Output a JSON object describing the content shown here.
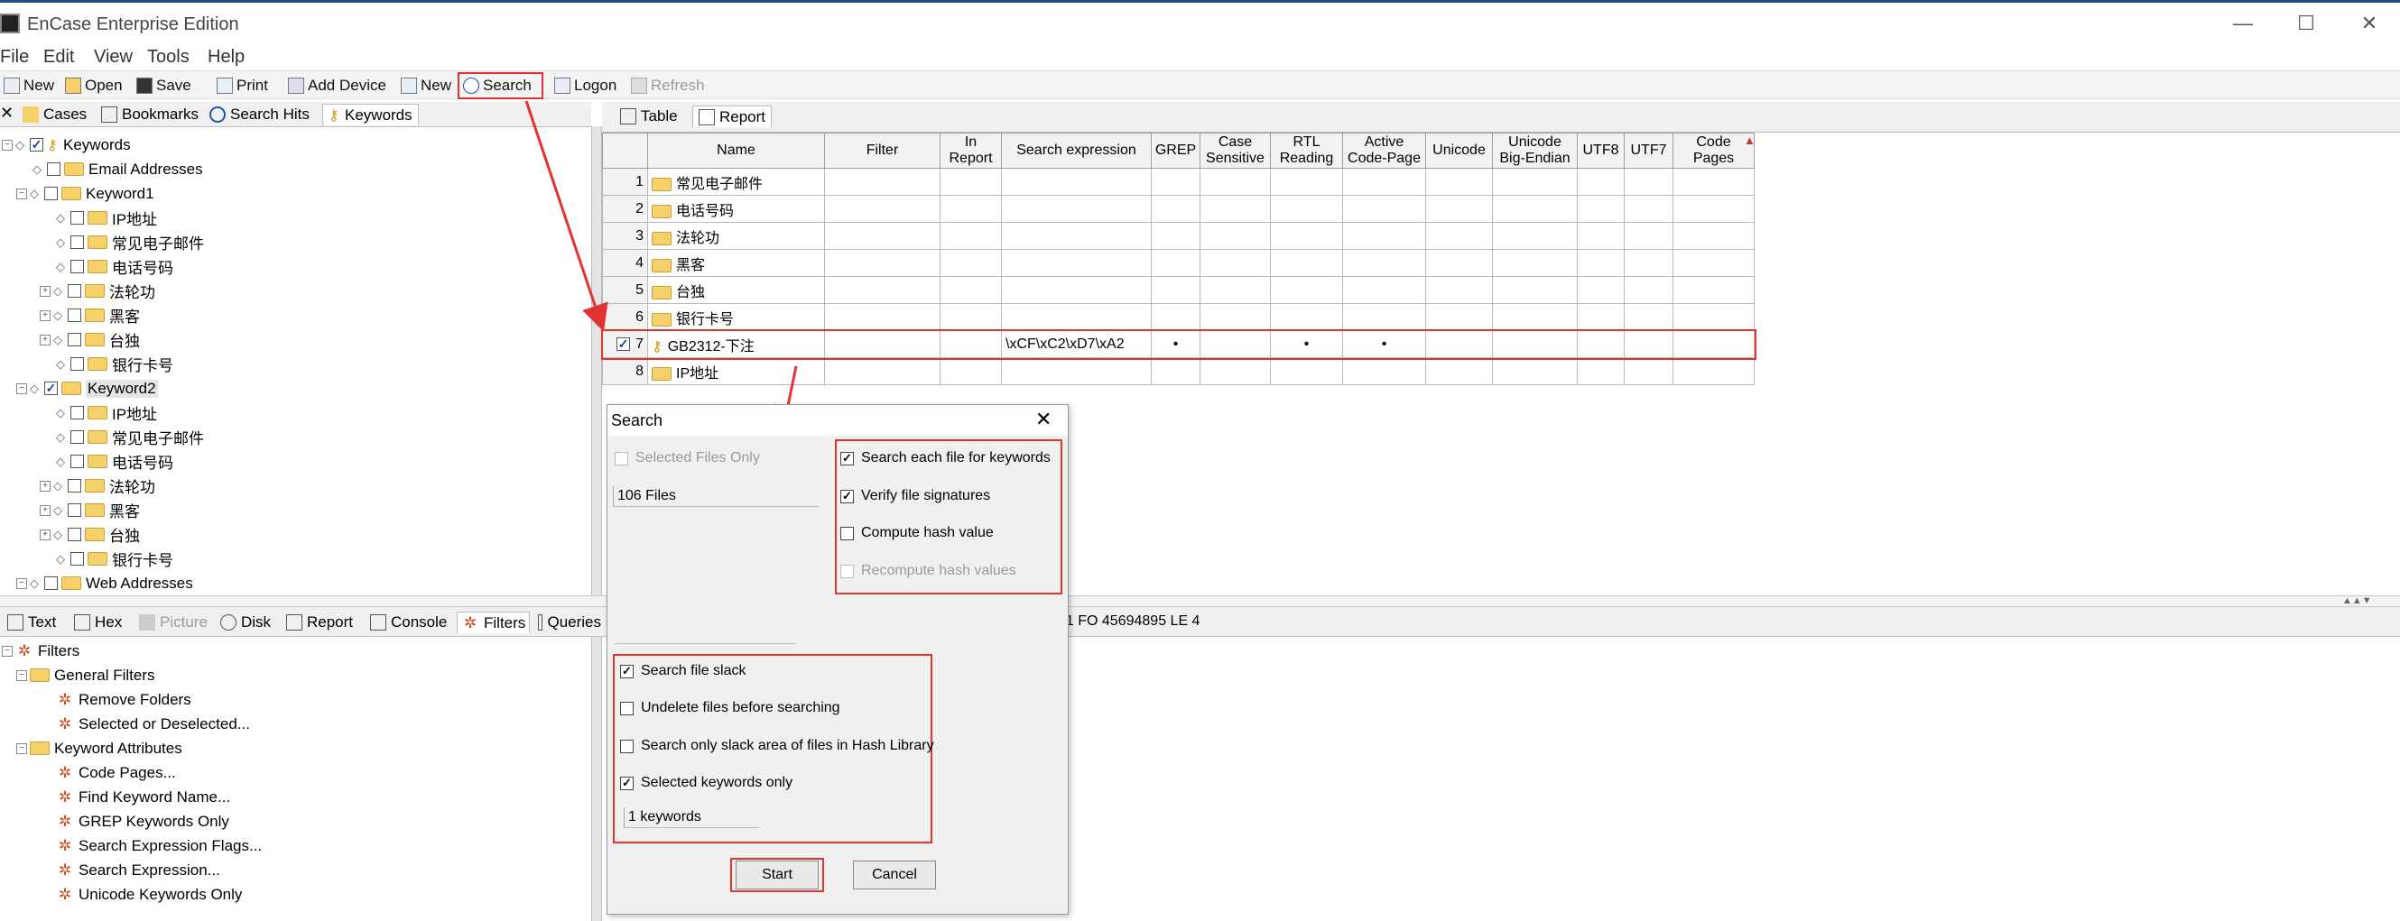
{
  "window": {
    "title": "EnCase Enterprise Edition",
    "controls": [
      "—",
      "☐",
      "✕"
    ]
  },
  "menu": [
    "File",
    "Edit",
    "View",
    "Tools",
    "Help"
  ],
  "toolbar": {
    "new": "New",
    "open": "Open",
    "save": "Save",
    "print": "Print",
    "add_device": "Add Device",
    "new2": "New",
    "search": "Search",
    "logon": "Logon",
    "refresh": "Refresh"
  },
  "left_tabs": [
    "Cases",
    "Bookmarks",
    "Search Hits",
    "Keywords"
  ],
  "right_tabs": [
    "Table",
    "Report"
  ],
  "tree": {
    "root": "Keywords",
    "items": [
      "Email Addresses",
      "Keyword1",
      "IP地址",
      "常见电子邮件",
      "电话号码",
      "法轮功",
      "黑客",
      "台独",
      "银行卡号",
      "Keyword2",
      "IP地址",
      "常见电子邮件",
      "电话号码",
      "法轮功",
      "黑客",
      "台独",
      "银行卡号",
      "Web Addresses"
    ]
  },
  "table": {
    "headers": [
      "Name",
      "Filter",
      "In Report",
      "Search expression",
      "GREP",
      "Case Sensitive",
      "RTL Reading",
      "Active Code-Page",
      "Unicode",
      "Unicode Big-Endian",
      "UTF8",
      "UTF7",
      "Code Pages"
    ],
    "rows": [
      {
        "num": "1",
        "name": "常见电子邮件",
        "expr": ""
      },
      {
        "num": "2",
        "name": "电话号码",
        "expr": ""
      },
      {
        "num": "3",
        "name": "法轮功",
        "expr": ""
      },
      {
        "num": "4",
        "name": "黑客",
        "expr": ""
      },
      {
        "num": "5",
        "name": "台独",
        "expr": ""
      },
      {
        "num": "6",
        "name": "银行卡号",
        "expr": ""
      },
      {
        "num": "7",
        "name": "GB2312-下注",
        "expr": "\\xCF\\xC2\\xD7\\xA2",
        "grep": "•",
        "rtl": "•",
        "active": "•"
      },
      {
        "num": "8",
        "name": "IP地址",
        "expr": ""
      }
    ]
  },
  "bottom_tabs": [
    "Text",
    "Hex",
    "Picture",
    "Disk",
    "Report",
    "Console",
    "Filters",
    "Queries"
  ],
  "status_text": "31 FO 45694895 LE 4",
  "filters": {
    "root": "Filters",
    "general": "General Filters",
    "general_items": [
      "Remove Folders",
      "Selected or Deselected..."
    ],
    "keyword_attr": "Keyword Attributes",
    "keyword_items": [
      "Code Pages...",
      "Find Keyword Name...",
      "GREP Keywords Only",
      "Search Expression Flags...",
      "Search Expression...",
      "Unicode Keywords Only"
    ]
  },
  "dialog": {
    "title": "Search",
    "selected_files_only": "Selected Files Only",
    "files_count": "106 Files",
    "search_each_file": "Search each file for keywords",
    "verify_signatures": "Verify file signatures",
    "compute_hash": "Compute hash value",
    "recompute_hash": "Recompute hash values",
    "search_slack": "Search file slack",
    "undelete": "Undelete files before searching",
    "slack_only_hash": "Search only slack area of files in Hash Library",
    "selected_keywords_only": "Selected keywords only",
    "keywords_count": "1 keywords",
    "start": "Start",
    "cancel": "Cancel"
  }
}
